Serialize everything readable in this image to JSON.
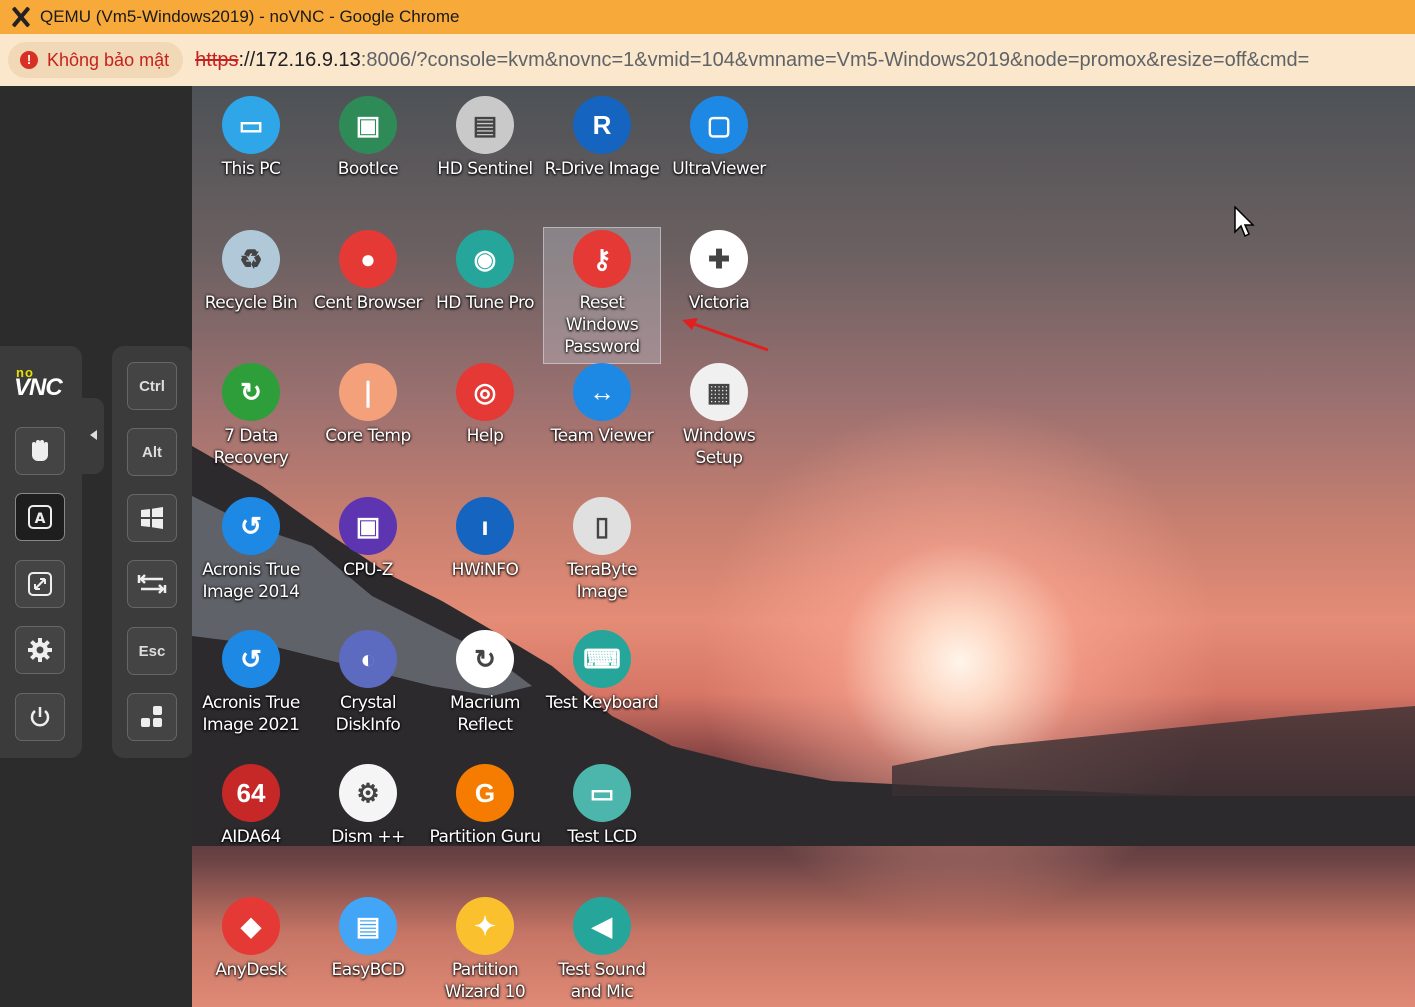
{
  "browser": {
    "window_title": "QEMU (Vm5-Windows2019) - noVNC - Google Chrome",
    "security_label": "Không bảo mật",
    "url_scheme": "https",
    "url_host": "://172.16.9.13",
    "url_rest": ":8006/?console=kvm&novnc=1&vmid=104&vmname=Vm5-Windows2019&node=promox&resize=off&cmd="
  },
  "novnc": {
    "logo_no": "no",
    "logo_vnc": "VNC",
    "keys": {
      "ctrl": "Ctrl",
      "alt": "Alt",
      "esc": "Esc"
    }
  },
  "desktop": {
    "icons": [
      {
        "label": "This PC",
        "icon": "monitor-icon",
        "color": "#2ea6e8"
      },
      {
        "label": "BootIce",
        "icon": "floppy-icon",
        "color": "#2e8b57"
      },
      {
        "label": "HD Sentinel",
        "icon": "harddisk-icon",
        "color": "#c9c9c9"
      },
      {
        "label": "R-Drive Image",
        "icon": "rdrive-icon",
        "color": "#1565c0"
      },
      {
        "label": "UltraViewer",
        "icon": "ultraviewer-icon",
        "color": "#1e88e5"
      },
      {
        "label": "Recycle Bin",
        "icon": "recycle-bin-icon",
        "color": "#b0c8d8"
      },
      {
        "label": "Cent Browser",
        "icon": "browser-icon",
        "color": "#e53935"
      },
      {
        "label": "HD Tune Pro",
        "icon": "hdtune-icon",
        "color": "#26a69a"
      },
      {
        "label": "Reset Windows Password",
        "icon": "key-icon",
        "color": "#e53935"
      },
      {
        "label": "Victoria",
        "icon": "green-cross-icon",
        "color": "#ffffff"
      },
      {
        "label": "7 Data Recovery",
        "icon": "recovery-icon",
        "color": "#2e9e3a"
      },
      {
        "label": "Core Temp",
        "icon": "thermometer-icon",
        "color": "#f4a07a"
      },
      {
        "label": "Help",
        "icon": "lifebuoy-icon",
        "color": "#e53935"
      },
      {
        "label": "Team Viewer",
        "icon": "teamviewer-icon",
        "color": "#1e88e5"
      },
      {
        "label": "Windows Setup",
        "icon": "windows-setup-icon",
        "color": "#f0f0f0"
      },
      {
        "label": "Acronis True Image 2014",
        "icon": "acronis-icon",
        "color": "#1e88e5"
      },
      {
        "label": "CPU-Z",
        "icon": "cpu-icon",
        "color": "#5e35b1"
      },
      {
        "label": "HWiNFO",
        "icon": "hwinfo-icon",
        "color": "#1565c0"
      },
      {
        "label": "TeraByte Image",
        "icon": "terabyte-icon",
        "color": "#e0e0e0"
      },
      {
        "label": "Acronis True Image 2021",
        "icon": "acronis-icon",
        "color": "#1e88e5"
      },
      {
        "label": "Crystal DiskInfo",
        "icon": "crystal-disk-icon",
        "color": "#5c6bc0"
      },
      {
        "label": "Macrium Reflect",
        "icon": "macrium-icon",
        "color": "#ffffff"
      },
      {
        "label": "Test Keyboard",
        "icon": "keyboard-icon",
        "color": "#26a69a"
      },
      {
        "label": "AIDA64",
        "icon": "aida64-icon",
        "color": "#c62828"
      },
      {
        "label": "Dism ++",
        "icon": "gear-icon",
        "color": "#f5f5f5"
      },
      {
        "label": "Partition Guru",
        "icon": "partition-guru-icon",
        "color": "#f57c00"
      },
      {
        "label": "Test LCD",
        "icon": "lcd-icon",
        "color": "#4db6ac"
      },
      {
        "label": "AnyDesk",
        "icon": "anydesk-icon",
        "color": "#e53935"
      },
      {
        "label": "EasyBCD",
        "icon": "easybcd-icon",
        "color": "#42a5f5"
      },
      {
        "label": "Partition Wizard 10",
        "icon": "partition-wizard-icon",
        "color": "#fbc02d"
      },
      {
        "label": "Test Sound and Mic",
        "icon": "speaker-icon",
        "color": "#26a69a"
      }
    ],
    "glyphs": [
      "▭",
      "▣",
      "▤",
      "R",
      "▢",
      "♻",
      "●",
      "◉",
      "⚷",
      "✚",
      "↻",
      "❘",
      "◎",
      "↔",
      "▦",
      "↺",
      "▣",
      "ı",
      "▯",
      "↺",
      "◐",
      "↻",
      "⌨",
      "64",
      "⚙",
      "G",
      "▭",
      "◆",
      "▤",
      "✦",
      "◀"
    ]
  }
}
